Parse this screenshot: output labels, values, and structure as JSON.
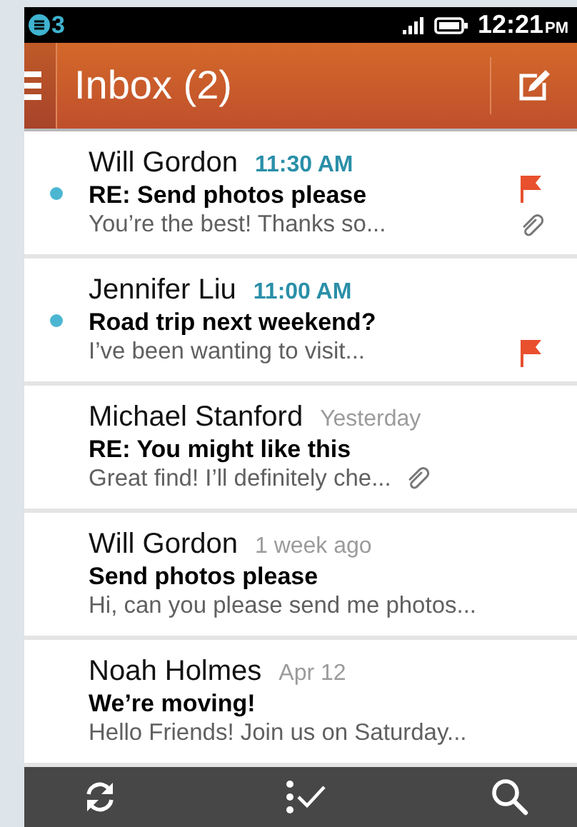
{
  "status_bar": {
    "notification_count": "3",
    "time": "12:21",
    "meridiem": "PM"
  },
  "header": {
    "title": "Inbox (2)"
  },
  "messages": [
    {
      "sender": "Will Gordon",
      "time": "11:30 AM",
      "subject": "RE: Send photos please",
      "preview": "You’re the best! Thanks so...",
      "unread": true,
      "flagged": true,
      "attachment": true
    },
    {
      "sender": "Jennifer Liu",
      "time": "11:00 AM",
      "subject": "Road trip next weekend?",
      "preview": "I’ve been wanting to visit...",
      "unread": true,
      "flagged": true,
      "attachment": false
    },
    {
      "sender": "Michael Stanford",
      "time": "Yesterday",
      "subject": "RE: You might like this",
      "preview": "Great find! I’ll definitely che...",
      "unread": false,
      "flagged": false,
      "attachment": true
    },
    {
      "sender": "Will Gordon",
      "time": "1 week ago",
      "subject": "Send photos please",
      "preview": "Hi, can you please send me photos...",
      "unread": false,
      "flagged": false,
      "attachment": false
    },
    {
      "sender": "Noah Holmes",
      "time": "Apr 12",
      "subject": "We’re moving!",
      "preview": "Hello Friends! Join us on Saturday...",
      "unread": false,
      "flagged": false,
      "attachment": false
    }
  ]
}
